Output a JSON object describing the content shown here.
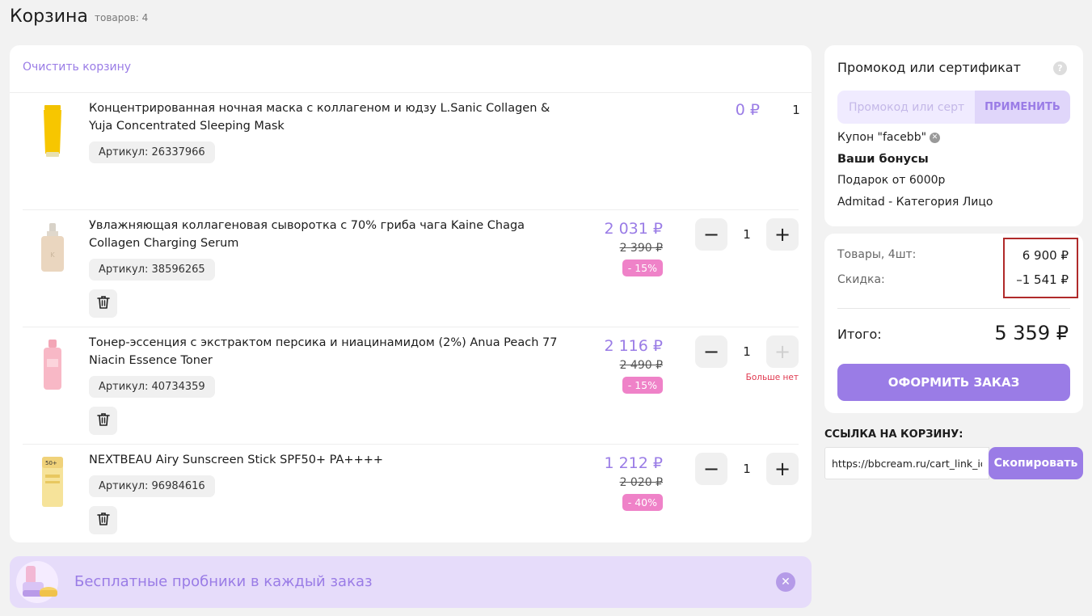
{
  "header": {
    "title": "Корзина",
    "items_count": "товаров: 4"
  },
  "cart": {
    "clear_label": "Очистить корзину",
    "items": [
      {
        "name": "Концентрированная ночная маска с коллагеном и юдзу L.Sanic Collagen & Yuja Concentrated Sleeping Mask",
        "sku": "Артикул: 26337966",
        "price": "0 ₽",
        "quantity": "1"
      },
      {
        "name": "Увлажняющая коллагеновая сыворотка с 70% гриба чага Kaine Chaga Collagen Charging Serum",
        "sku": "Артикул: 38596265",
        "price": "2 031 ₽",
        "old_price": "2 390 ₽",
        "discount": "- 15%",
        "quantity": "1"
      },
      {
        "name": "Тонер-эссенция с экстрактом персика и ниацинамидом (2%) Anua Peach 77 Niacin Essence Toner",
        "sku": "Артикул: 40734359",
        "price": "2 116 ₽",
        "old_price": "2 490 ₽",
        "discount": "- 15%",
        "quantity": "1",
        "stock_note": "Больше нет"
      },
      {
        "name": "NEXTBEAU Airy Sunscreen Stick SPF50+ PA++++",
        "sku": "Артикул: 96984616",
        "price": "1 212 ₽",
        "old_price": "2 020 ₽",
        "discount": "- 40%",
        "quantity": "1"
      }
    ],
    "minus_symbol": "−",
    "plus_symbol": "+"
  },
  "samples_banner": {
    "text": "Бесплатные пробники в каждый заказ",
    "close_symbol": "✕"
  },
  "promo": {
    "title": "Промокод или сертификат",
    "help_symbol": "?",
    "input_placeholder": "Промокод или сертификат",
    "apply_label": "ПРИМЕНИТЬ",
    "coupon": "Купон \"facebb\"",
    "coupon_remove_symbol": "✕",
    "bonuses_title": "Ваши бонусы",
    "bonuses": [
      "Подарок от 6000р",
      "Admitad - Категория Лицо"
    ]
  },
  "summary": {
    "goods_label": "Товары, 4шт:",
    "goods_value": "6 900 ₽",
    "discount_label": "Скидка:",
    "discount_value": "–1 541 ₽",
    "total_label": "Итого:",
    "total_value": "5 359 ₽",
    "checkout_label": "ОФОРМИТЬ ЗАКАЗ"
  },
  "cart_link": {
    "title": "ССЫЛКА НА КОРЗИНУ:",
    "url": "https://bbcream.ru/cart_link_id/",
    "copy_label": "Скопировать"
  },
  "colors": {
    "accent": "#9a7ce6",
    "discount_badge": "#ef82c8",
    "highlight_border": "#b02a2a",
    "stock_warning": "#e0384f"
  }
}
